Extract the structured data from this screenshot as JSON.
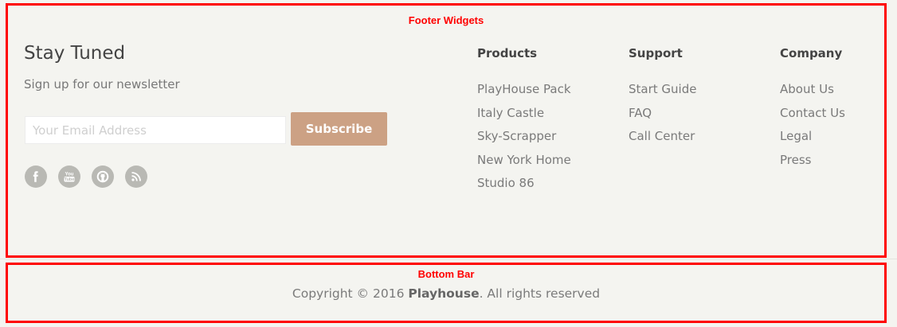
{
  "footer_widgets": {
    "region_label": "Footer Widgets",
    "newsletter": {
      "title": "Stay Tuned",
      "subtitle": "Sign up for our newsletter",
      "email_placeholder": "Your Email Address",
      "email_value": "",
      "subscribe_label": "Subscribe"
    },
    "social_icons": [
      "facebook-icon",
      "youtube-icon",
      "github-icon",
      "rss-icon"
    ],
    "columns": [
      {
        "title": "Products",
        "links": [
          "PlayHouse Pack",
          "Italy Castle",
          "Sky-Scrapper",
          "New York Home",
          "Studio 86"
        ]
      },
      {
        "title": "Support",
        "links": [
          "Start Guide",
          "FAQ",
          "Call Center"
        ]
      },
      {
        "title": "Company",
        "links": [
          "About Us",
          "Contact Us",
          "Legal",
          "Press"
        ]
      }
    ]
  },
  "bottom_bar": {
    "region_label": "Bottom Bar",
    "copyright_prefix": "Copyright © 2016 ",
    "brand": "Playhouse",
    "copyright_suffix": ". All rights reserved"
  },
  "colors": {
    "background": "#f4f4f0",
    "accent_button": "#cca184",
    "annotation_red": "#ff0000",
    "social_icon_bg": "#b9b9b4"
  }
}
